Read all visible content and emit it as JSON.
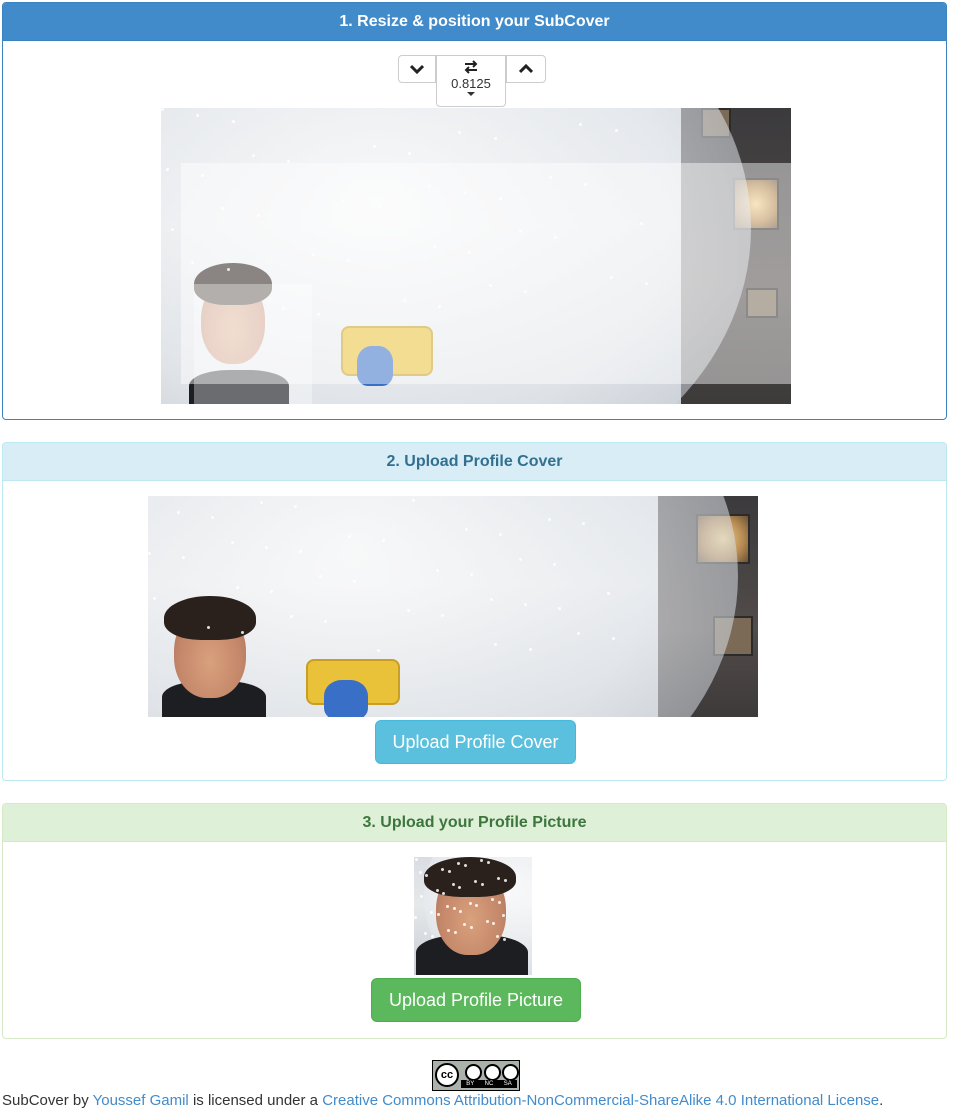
{
  "step1": {
    "title": "1. Resize & position your SubCover",
    "zoom_value": "0.8125",
    "down_icon": "chevron-down-icon",
    "up_icon": "chevron-up-icon",
    "swap_icon": "swap-arrows-icon"
  },
  "step2": {
    "title": "2. Upload Profile Cover",
    "button_label": "Upload Profile Cover"
  },
  "step3": {
    "title": "3. Upload your Profile Picture",
    "button_label": "Upload Profile Picture"
  },
  "footer": {
    "work_title": "SubCover",
    "by_text": " by ",
    "author": "Youssef Gamil",
    "licensed_text": " is licensed under a ",
    "license": "Creative Commons Attribution-NonCommercial-ShareAlike 4.0 International License",
    "end": ".",
    "badge_labels": [
      "cc",
      "BY",
      "NC",
      "SA"
    ]
  },
  "colors": {
    "primary": "#428bca",
    "info": "#5bc0de",
    "success": "#5cb85c",
    "link": "#428bca"
  }
}
